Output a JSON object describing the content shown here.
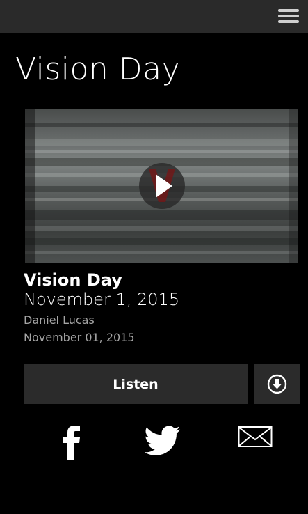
{
  "header": {
    "menu_icon": "hamburger-menu-icon"
  },
  "page": {
    "title": "Vision Day"
  },
  "video": {
    "play_icon": "play-icon"
  },
  "episode": {
    "title": "Vision Day",
    "date": "November 1, 2015",
    "speaker": "Daniel Lucas",
    "published": "November 01, 2015"
  },
  "actions": {
    "listen_label": "Listen",
    "download_icon": "download-icon"
  },
  "share": {
    "icons": [
      "facebook-icon",
      "twitter-icon",
      "email-icon"
    ]
  },
  "colors": {
    "background": "#000000",
    "topbar": "#2a2a2a",
    "button": "#2b2b2b",
    "secondary_text": "#a5a5a5"
  }
}
